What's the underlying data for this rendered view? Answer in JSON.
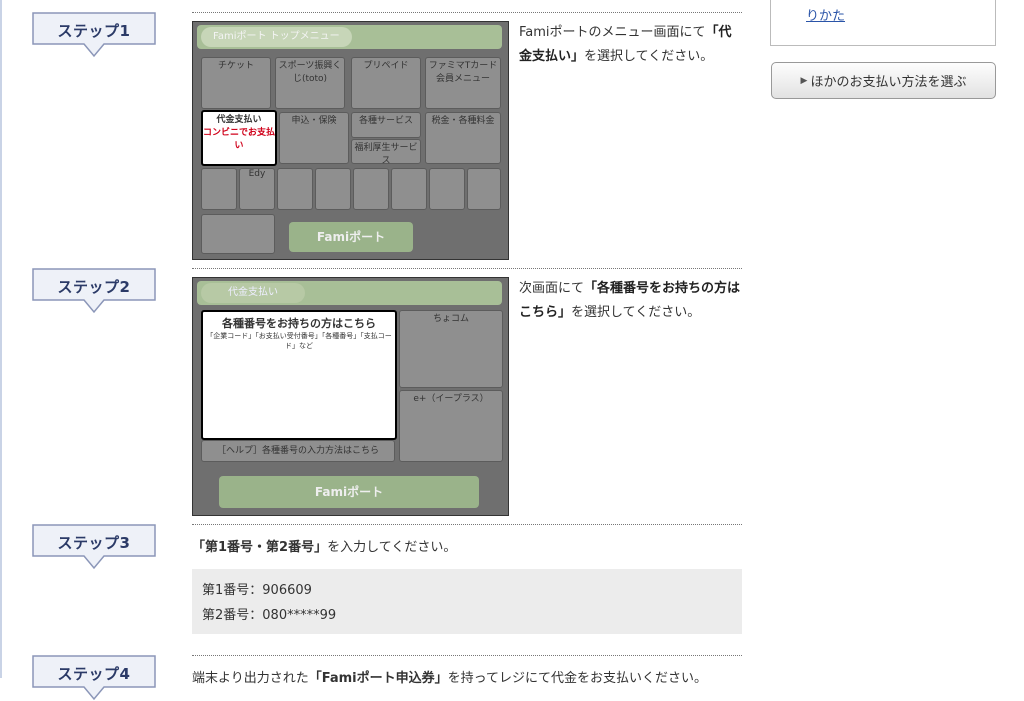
{
  "sidebar": {
    "link_text": "りかた",
    "other_payment_button": "ほかのお支払い方法を選ぶ"
  },
  "steps": [
    {
      "badge": "ステップ1",
      "desc_prefix": "Famiポートのメニュー画面にて",
      "desc_bold": "「代金支払い」",
      "desc_suffix": "を選択してください。",
      "screen": {
        "header": "Famiポート トップメニュー",
        "selected_title": "代金支払い",
        "selected_sub": "コンビニでお支払い",
        "tile_labels": [
          "チケット",
          "スポーツ振興くじ(toto)",
          "プリペイド",
          "ファミマTカード会員メニュー",
          "申込・保険",
          "各種サービス",
          "税金・各種料金",
          "福利厚生サービス",
          "Edy"
        ],
        "footer": "Famiポート"
      }
    },
    {
      "badge": "ステップ2",
      "desc_prefix": "次画面にて",
      "desc_bold": "「各種番号をお持ちの方はこちら」",
      "desc_suffix": "を選択してください。",
      "screen": {
        "header": "代金支払い",
        "box_title": "各種番号をお持ちの方はこちら",
        "box_sub": "「企業コード」「お支払い受付番号」「各種番号」「支払コード」など",
        "help": "［ヘルプ］各種番号の入力方法はこちら",
        "right_top": "ちょコム",
        "right_bottom": "e+（イープラス）",
        "footer": "Famiポート"
      }
    },
    {
      "badge": "ステップ3",
      "instruction_bold": "「第1番号・第2番号」",
      "instruction_suffix": "を入力してください。",
      "number1": "第1番号：906609",
      "number2": "第2番号：080*****99"
    },
    {
      "badge": "ステップ4",
      "instruction_prefix": "端末より出力された",
      "instruction_bold": "「Famiポート申込券」",
      "instruction_suffix": "を持ってレジにて代金をお支払いください。"
    }
  ]
}
